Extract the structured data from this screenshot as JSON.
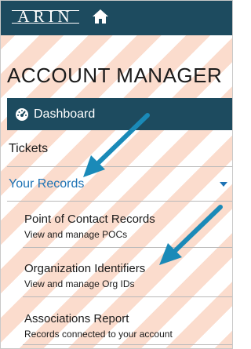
{
  "header": {
    "logo_text": "ARIN",
    "home_icon": "home-icon"
  },
  "page": {
    "title": "ACCOUNT MANAGER"
  },
  "nav": {
    "dashboard": {
      "label": "Dashboard",
      "icon": "gauge-icon"
    },
    "tickets": {
      "label": "Tickets"
    },
    "your_records": {
      "label": "Your Records",
      "expanded": true,
      "icon": "caret-down-icon"
    }
  },
  "records_menu": [
    {
      "label": "Point of Contact Records",
      "description": "View and manage POCs"
    },
    {
      "label": "Organization Identifiers",
      "description": "View and manage Org IDs"
    },
    {
      "label": "Associations Report",
      "description": "Records connected to your account"
    }
  ],
  "colors": {
    "header_bg": "#1d4b5f",
    "link_blue": "#1e73b5",
    "stripe": "#fbdccd",
    "annotation_arrow": "#1a8ab8"
  }
}
